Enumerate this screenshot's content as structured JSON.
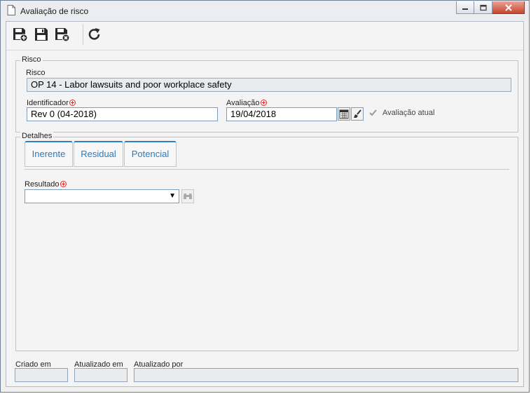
{
  "window": {
    "title": "Avaliação de risco"
  },
  "toolbar": {
    "buttons": [
      {
        "name": "save-new",
        "icon": "save-plus-icon"
      },
      {
        "name": "save",
        "icon": "save-icon"
      },
      {
        "name": "save-close",
        "icon": "save-close-icon"
      },
      {
        "name": "refresh",
        "icon": "refresh-icon"
      }
    ]
  },
  "risco": {
    "legend": "Risco",
    "field_label": "Risco",
    "field_value": "OP 14 - Labor lawsuits and poor workplace safety",
    "identificador_label": "Identificador",
    "identificador_value": "Rev 0 (04-2018)",
    "avaliacao_label": "Avaliação",
    "avaliacao_value": "19/04/2018",
    "avaliacao_atual_label": "Avaliação atual",
    "avaliacao_atual_checked": true
  },
  "detalhes": {
    "legend": "Detalhes",
    "tabs": [
      "Inerente",
      "Residual",
      "Potencial"
    ],
    "resultado_label": "Resultado",
    "resultado_value": ""
  },
  "footer": {
    "criado_em_label": "Criado em",
    "atualizado_em_label": "Atualizado em",
    "atualizado_por_label": "Atualizado por",
    "criado_em_value": "",
    "atualizado_em_value": "",
    "atualizado_por_value": ""
  },
  "colors": {
    "accent": "#2b7bbf",
    "required": "#d62c2c",
    "border": "#7f9db9"
  }
}
